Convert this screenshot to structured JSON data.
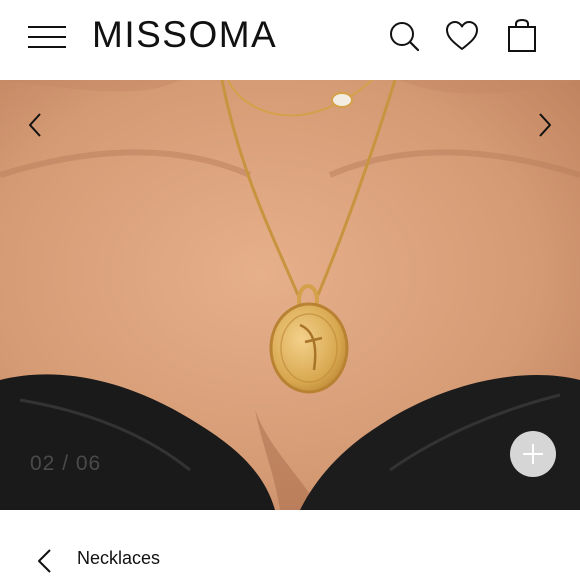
{
  "header": {
    "logo": "MISSOMA",
    "icons": [
      "menu-icon",
      "search-icon",
      "heart-icon",
      "bag-icon"
    ]
  },
  "gallery": {
    "counter": "02 / 06",
    "current_slide": 2,
    "total_slides": 6,
    "icons": [
      "chevron-left-icon",
      "chevron-right-icon",
      "plus-icon"
    ]
  },
  "breadcrumb": {
    "label": "Necklaces",
    "icon": "chevron-left-icon"
  },
  "colors": {
    "text": "#111111",
    "zoom_button": "#d6d6d6",
    "skin": "#d9a07c",
    "gold": "#d4a049"
  }
}
